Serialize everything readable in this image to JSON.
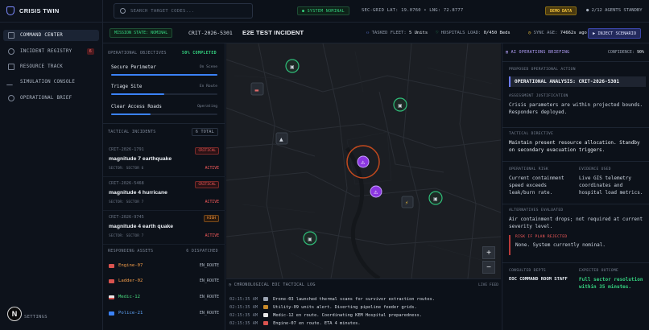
{
  "brand": {
    "title": "CRISIS TWIN"
  },
  "sidebar": {
    "items": [
      {
        "label": "COMMAND CENTER"
      },
      {
        "label": "INCIDENT REGISTRY",
        "badge": "6"
      },
      {
        "label": "RESOURCE TRACK"
      },
      {
        "label": "SIMULATION CONSOLE"
      },
      {
        "label": "OPERATIONAL BRIEF"
      }
    ],
    "avatar": "N",
    "settings": "SETTINGS"
  },
  "topbar": {
    "search_placeholder": "SEARCH TARGET CODES...",
    "system_status": "● SYSTEM NOMINAL",
    "coords": "SEC-GRID LAT: 19.0760 • LNG: 72.8777",
    "demo_badge": "DEMO DATA",
    "agents": "● 2/12 AGENTS STANDBY"
  },
  "header": {
    "mission_state": "MISSION STATE: NOMINAL",
    "crit_id": "CRIT-2026-5301",
    "incident_name": "E2E TEST INCIDENT",
    "tasked_fleet_label": "TASKED FLEET:",
    "tasked_fleet_value": "5 Units",
    "hospitals_label": "HOSPITALS LOAD:",
    "hospitals_value": "0/450 Beds",
    "sync_label": "SYNC AGE:",
    "sync_value": "74662s ago",
    "inject_button": "INJECT SCENARIO"
  },
  "objectives": {
    "title": "OPERATIONAL OBJECTIVES",
    "completed": "50% COMPLETED",
    "items": [
      {
        "name": "Secure Perimeter",
        "status": "On Scene",
        "progress": 1.0,
        "color": "#3b82f6"
      },
      {
        "name": "Triage Site",
        "status": "En Route",
        "progress": 0.5,
        "color": "#3b82f6"
      },
      {
        "name": "Clear Access Roads",
        "status": "Operating",
        "progress": 0.37,
        "color": "#3b82f6"
      }
    ]
  },
  "incidents": {
    "title": "TACTICAL INCIDENTS",
    "total": "6 TOTAL",
    "items": [
      {
        "id": "CRIT-2026-1791",
        "title": "magnitude 7 earthquake",
        "sector": "SECTOR: SECTOR 6",
        "severity": "CRITICAL",
        "status": "ACTIVE"
      },
      {
        "id": "CRIT-2026-5468",
        "title": "magnitude 4 hurricane",
        "sector": "SECTOR: SECTOR 7",
        "severity": "CRITICAL",
        "status": "ACTIVE"
      },
      {
        "id": "CRIT-2026-9745",
        "title": "magnitude 4 earth quake",
        "sector": "SECTOR: SECTOR 7",
        "severity": "HIGH",
        "status": "ACTIVE"
      }
    ]
  },
  "assets": {
    "title": "RESPONDING ASSETS",
    "dispatched": "6 DISPATCHED",
    "items": [
      {
        "name": "Engine-07",
        "status": "EN_ROUTE",
        "color": "#f59e4a",
        "icon": "fire-truck-icon"
      },
      {
        "name": "Ladder-02",
        "status": "EN_ROUTE",
        "color": "#f59e4a",
        "icon": "ladder-truck-icon"
      },
      {
        "name": "Medic-12",
        "status": "EN_ROUTE",
        "color": "#4ade80",
        "icon": "ambulance-icon"
      },
      {
        "name": "Police-21",
        "status": "EN_ROUTE",
        "color": "#60a5fa",
        "icon": "police-car-icon"
      }
    ]
  },
  "map": {
    "zoom_in": "+",
    "zoom_out": "−"
  },
  "log": {
    "title": "CHRONOLOGICAL EOC TACTICAL LOG",
    "live": "LIVE FEED",
    "entries": [
      {
        "time": "02:15:35 AM",
        "text": "Drone-03 launched thermal scans for survivor extraction routes."
      },
      {
        "time": "02:15:35 AM",
        "text": "Utility-09 units alert. Diverting pipeline feeder grids."
      },
      {
        "time": "02:15:35 AM",
        "text": "Medic-12 en route. Coordinating KEM Hospital preparedness."
      },
      {
        "time": "02:15:35 AM",
        "text": "Engine-07 en route. ETA 4 minutes."
      }
    ]
  },
  "briefing": {
    "title": "AI OPERATIONS BRIEFING",
    "confidence_label": "CONFIDENCE:",
    "confidence_value": "90%",
    "proposed_label": "PROPOSED OPERATIONAL ACTION",
    "proposed_value": "OPERATIONAL ANALYSIS: CRIT-2026-5301",
    "justification_label": "ASSESSMENT JUSTIFICATION",
    "justification_text": "Crisis parameters are within projected bounds. Responders deployed.",
    "directive_label": "TACTICAL DIRECTIVE",
    "directive_text": "Maintain present resource allocation. Standby on secondary evacuation triggers.",
    "risk_label": "OPERATIONAL RISK",
    "risk_text": "Current containment speed exceeds leak/burn rate.",
    "evidence_label": "EVIDENCE USED",
    "evidence_text": "Live GIS telemetry coordinates and hospital load metrics.",
    "alternatives_label": "ALTERNATIVES EVALUATED",
    "alternatives_text": "Air containment drops; not required at current severity level.",
    "reject_label": "RISK IF PLAN REJECTED",
    "reject_text": "None. System currently nominal.",
    "consulted_label": "CONSULTED DEPTS",
    "consulted_value": "EOC COMMAND ROOM STAFF",
    "outcome_label": "EXPECTED OUTCOME",
    "outcome_value": "Full sector resolution within 35 minutes."
  }
}
